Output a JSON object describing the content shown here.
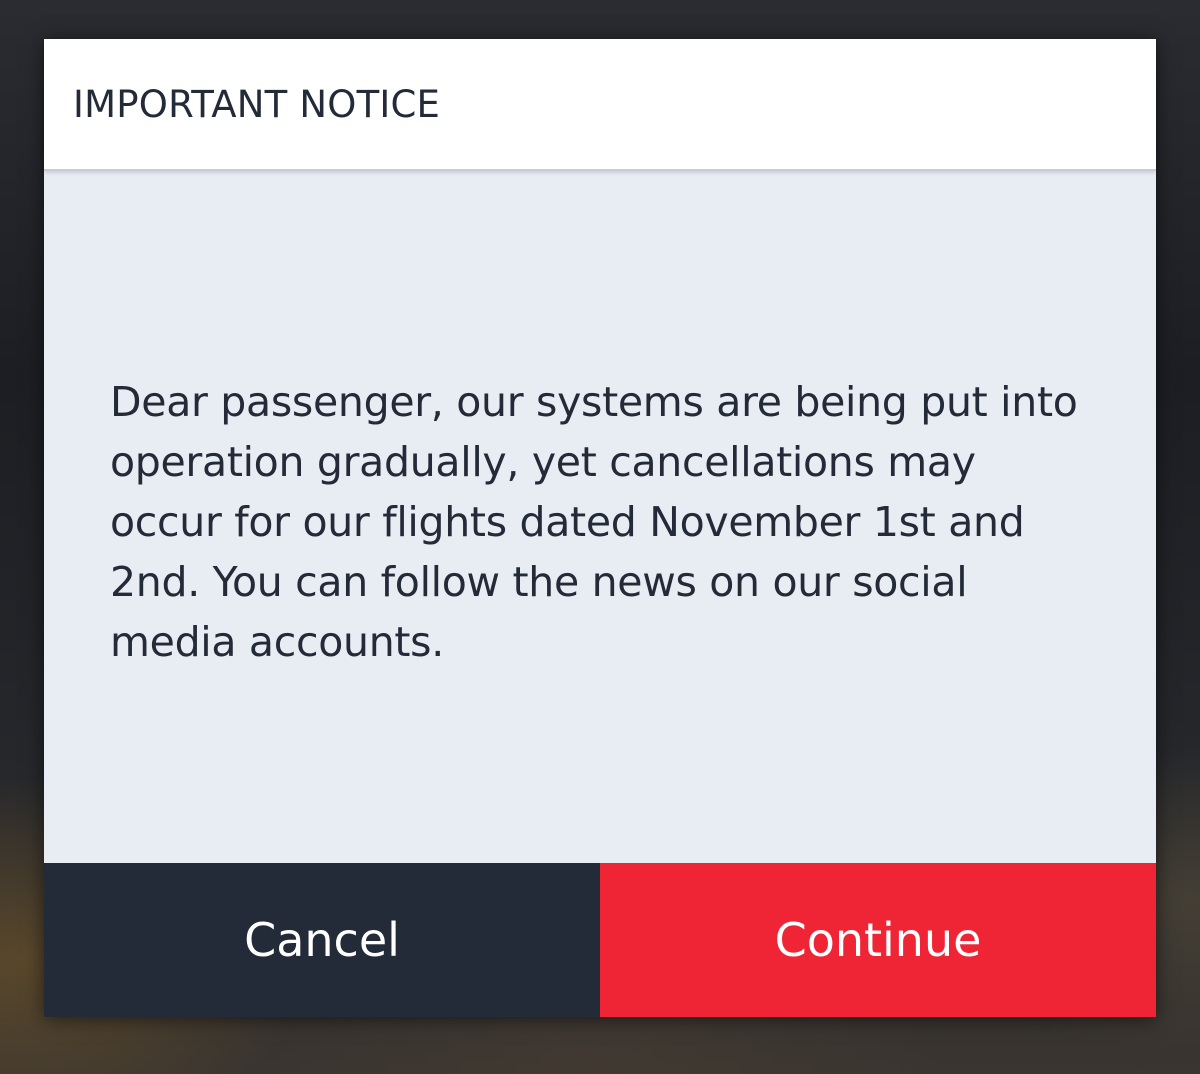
{
  "dialog": {
    "title": "IMPORTANT NOTICE",
    "message": "Dear passenger, our systems are being put into operation gradually, yet cancellations may occur for our flights dated November 1st and 2nd. You can follow the news on our social media accounts."
  },
  "actions": {
    "cancel_label": "Cancel",
    "continue_label": "Continue"
  },
  "colors": {
    "header_bg": "#ffffff",
    "body_bg": "#e8ecf3",
    "text": "#232a38",
    "cancel_bg": "#232a38",
    "continue_bg": "#ef2535"
  }
}
